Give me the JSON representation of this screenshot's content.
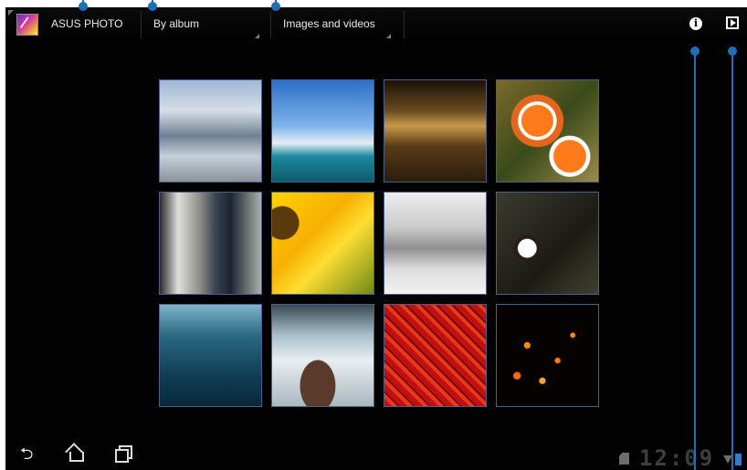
{
  "actionbar": {
    "app_title": "ASUS PHOTO",
    "group_by": "By album",
    "media_filter": "Images and videos",
    "icons": [
      "info-icon",
      "slideshow-icon"
    ]
  },
  "gallery": {
    "thumbnails": [
      "clouds-sky",
      "harbor-boats",
      "building-night",
      "clownfish-anemone",
      "couple-walking",
      "sunflower",
      "sleeping-kitten",
      "white-flower",
      "lake-water",
      "rock-waterfall",
      "red-lanterns",
      "sky-lanterns-night"
    ]
  },
  "statusbar": {
    "clock": "12:09"
  },
  "colors": {
    "callout": "#1f6fb8",
    "thumb_border": "#4a5f8a",
    "battery": "#2f7cd4"
  }
}
